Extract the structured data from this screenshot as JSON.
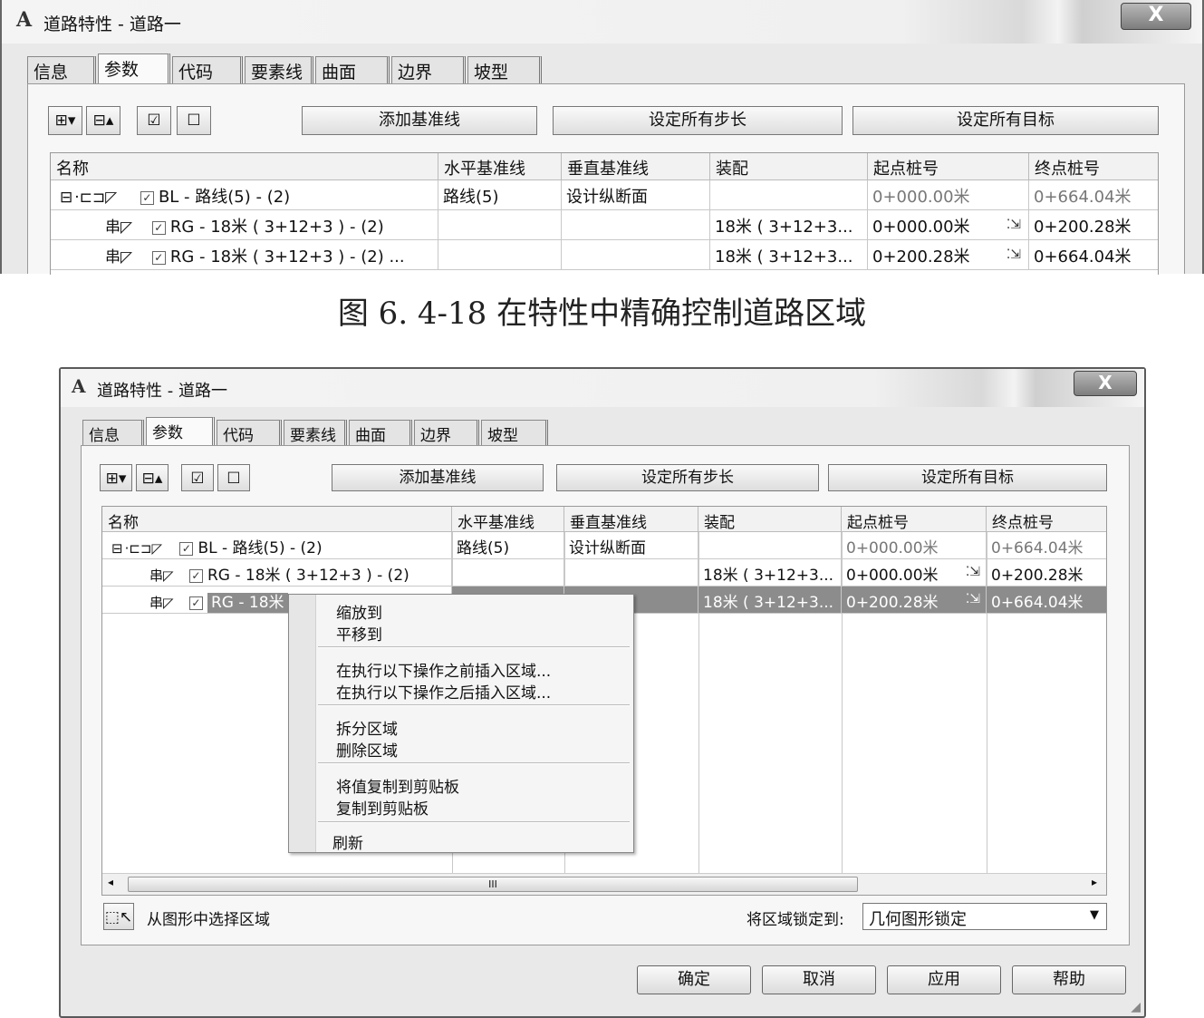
{
  "window": {
    "title": "道路特性 - 道路一",
    "app_icon": "A",
    "close_glyph": "X",
    "tabs": [
      "信息",
      "参数",
      "代码",
      "要素线",
      "曲面",
      "边界",
      "坡型"
    ],
    "toolbar": {
      "add_baseline": "添加基准线",
      "set_all_steps": "设定所有步长",
      "set_all_targets": "设定所有目标"
    },
    "columns": [
      "名称",
      "水平基准线",
      "垂直基准线",
      "装配",
      "起点桩号",
      "终点桩号"
    ],
    "rows": [
      {
        "name": "BL - 路线(5) - (2)",
        "horizontal": "路线(5)",
        "vertical": "设计纵断面",
        "assembly": "",
        "start": "0+000.00米",
        "end": "0+664.04米"
      },
      {
        "name": "RG - 18米 ( 3+12+3 ) - (2)",
        "horizontal": "",
        "vertical": "",
        "assembly": "18米 ( 3+12+3...",
        "start": "0+000.00米",
        "end": "0+200.28米"
      },
      {
        "name": "RG - 18米 ( 3+12+3 ) - (2) ...",
        "horizontal": "",
        "vertical": "",
        "assembly": "18米 ( 3+12+3...",
        "start": "0+200.28米",
        "end": "0+664.04米"
      }
    ],
    "row3_name_short": "RG - 18米"
  },
  "caption": "图 6. 4-18    在特性中精确控制道路区域",
  "context_menu": {
    "items": [
      "缩放到",
      "平移到",
      "在执行以下操作之前插入区域...",
      "在执行以下操作之后插入区域...",
      "拆分区域",
      "删除区域",
      "将值复制到剪贴板",
      "复制到剪贴板",
      "刷新"
    ]
  },
  "bottom": {
    "select_from_drawing": "从图形中选择区域",
    "lock_label": "将区域锁定到:",
    "lock_value": "几何图形锁定",
    "ok": "确定",
    "cancel": "取消",
    "apply": "应用",
    "help": "帮助",
    "scroll_grip": "III"
  }
}
